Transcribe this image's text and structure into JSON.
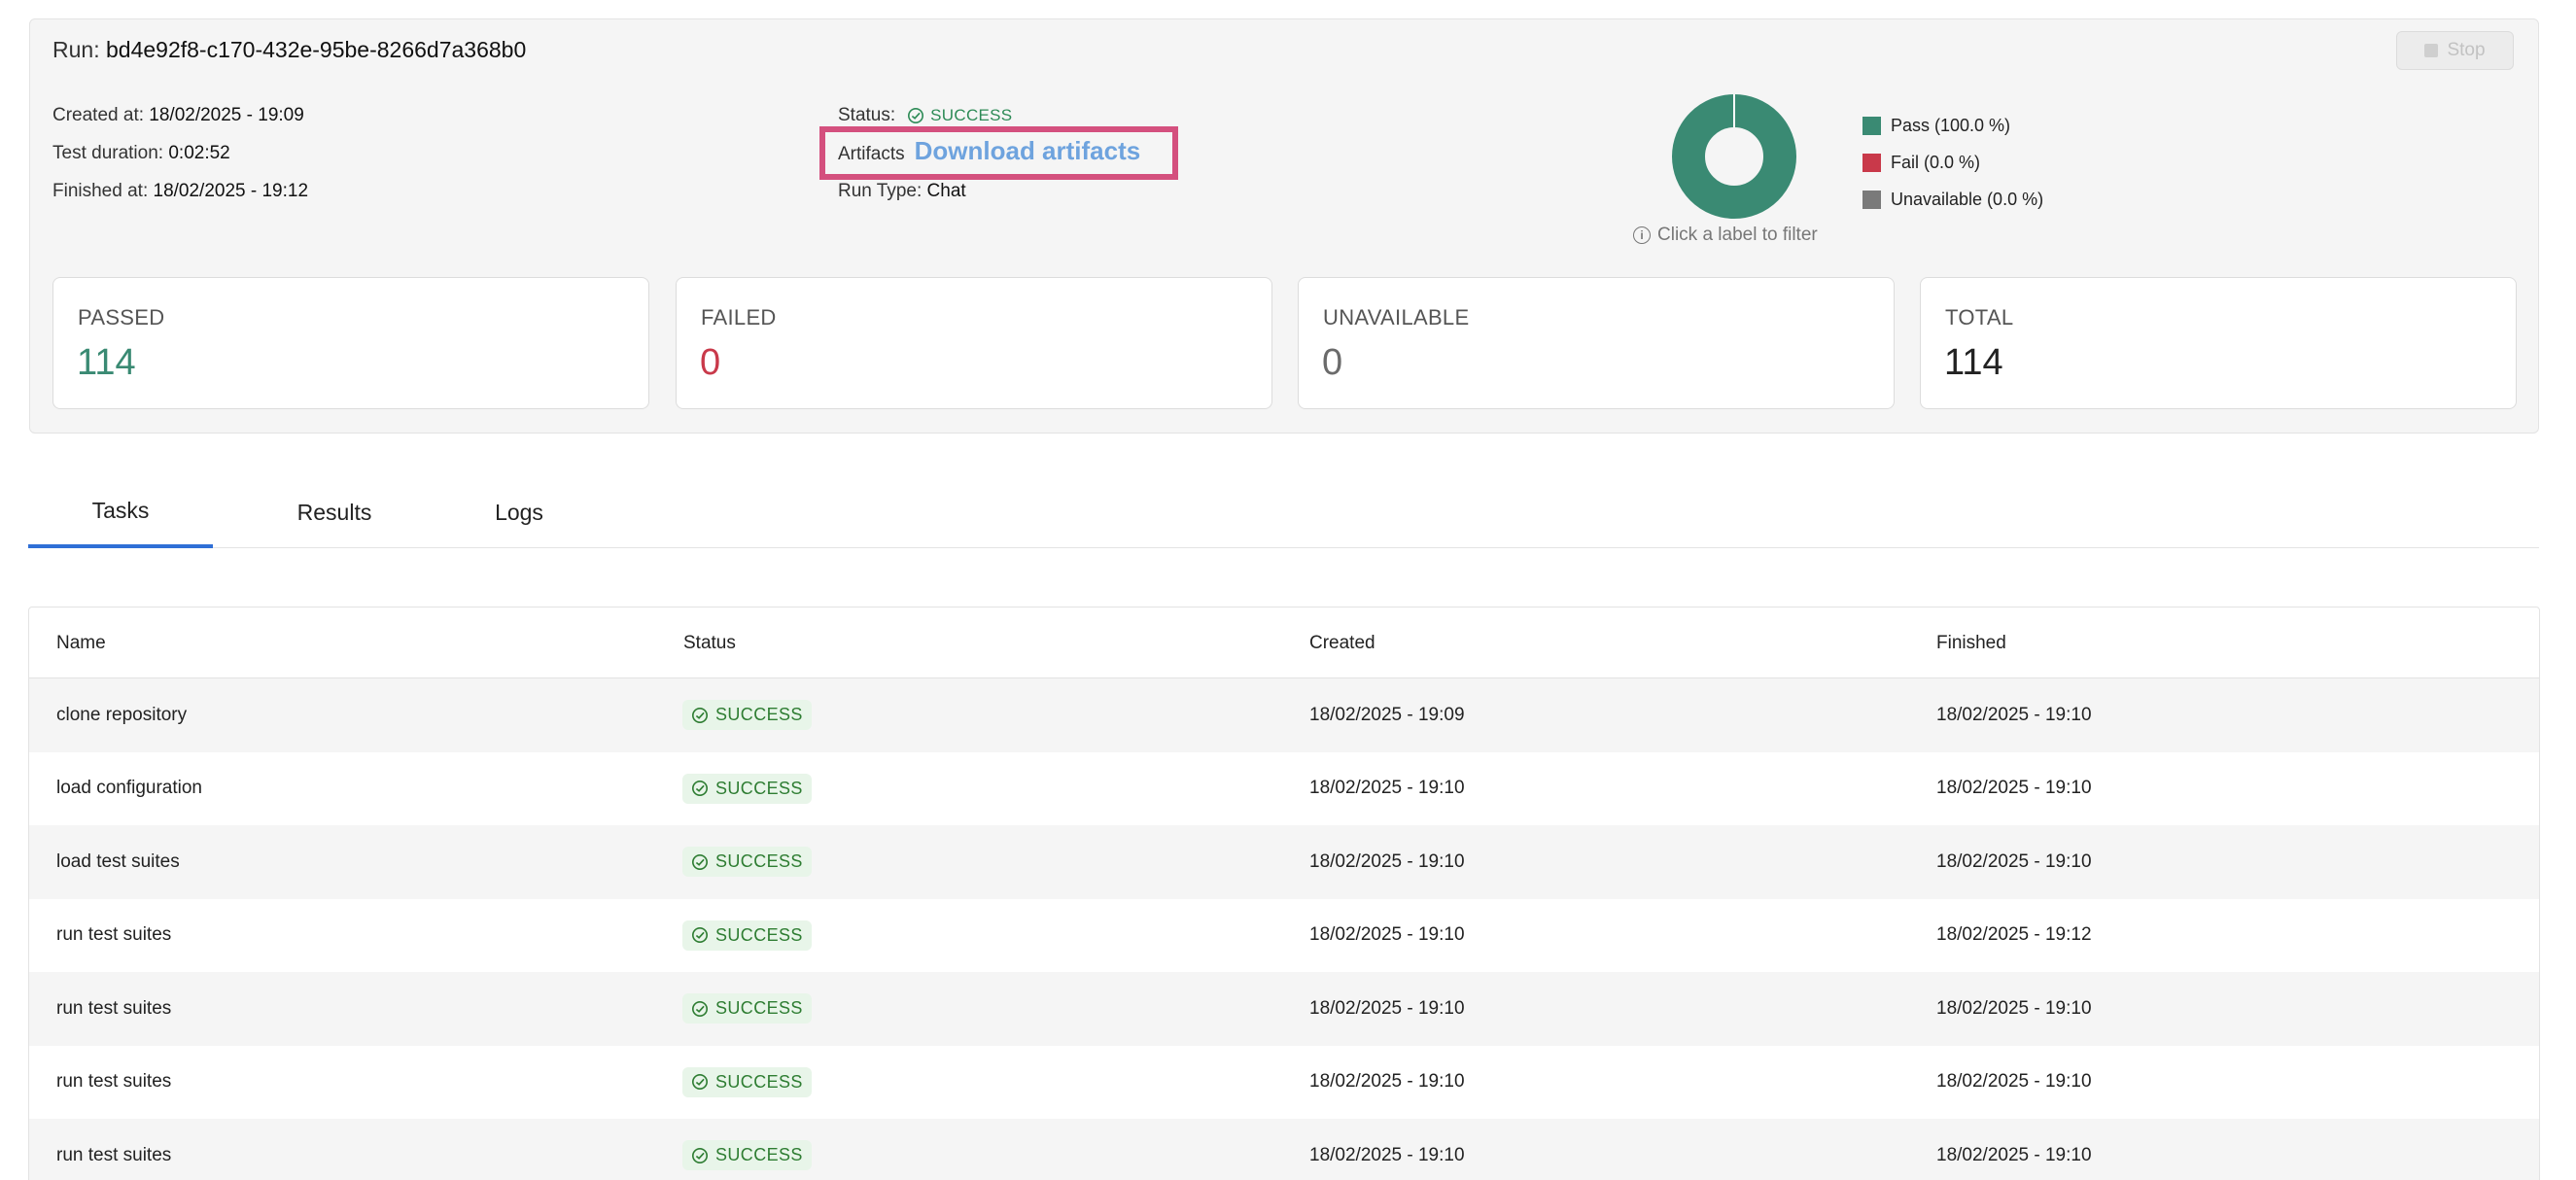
{
  "run": {
    "label": "Run:",
    "id": "bd4e92f8-c170-432e-95be-8266d7a368b0",
    "stop_label": "Stop"
  },
  "meta": {
    "created_label": "Created at:",
    "created_value": "18/02/2025 - 19:09",
    "duration_label": "Test duration:",
    "duration_value": "0:02:52",
    "finished_label": "Finished at:",
    "finished_value": "18/02/2025 - 19:12",
    "status_label": "Status:",
    "status_value": "SUCCESS",
    "artifacts_label": "Artifacts",
    "artifacts_link": "Download artifacts",
    "run_type_label": "Run Type:",
    "run_type_value": "Chat"
  },
  "chart_data": {
    "type": "pie",
    "categories": [
      "Pass",
      "Fail",
      "Unavailable"
    ],
    "values": [
      100.0,
      0.0,
      0.0
    ],
    "legend": [
      "Pass (100.0 %)",
      "Fail (0.0 %)",
      "Unavailable (0.0 %)"
    ],
    "colors": [
      "#3a8a73",
      "#c9394a",
      "#7a7a7a"
    ],
    "hint": "Click a label to filter",
    "legend_position": "right"
  },
  "cards": [
    {
      "label": "PASSED",
      "value": "114",
      "color": "#3a8a73"
    },
    {
      "label": "FAILED",
      "value": "0",
      "color": "#c9394a"
    },
    {
      "label": "UNAVAILABLE",
      "value": "0",
      "color": "#6b6b6b"
    },
    {
      "label": "TOTAL",
      "value": "114",
      "color": "#222222"
    }
  ],
  "tabs": [
    {
      "label": "Tasks",
      "active": true
    },
    {
      "label": "Results",
      "active": false
    },
    {
      "label": "Logs",
      "active": false
    }
  ],
  "table": {
    "headers": [
      "Name",
      "Status",
      "Created",
      "Finished"
    ],
    "rows": [
      {
        "name": "clone repository",
        "status": "SUCCESS",
        "created": "18/02/2025 - 19:09",
        "finished": "18/02/2025 - 19:10"
      },
      {
        "name": "load configuration",
        "status": "SUCCESS",
        "created": "18/02/2025 - 19:10",
        "finished": "18/02/2025 - 19:10"
      },
      {
        "name": "load test suites",
        "status": "SUCCESS",
        "created": "18/02/2025 - 19:10",
        "finished": "18/02/2025 - 19:10"
      },
      {
        "name": "run test suites",
        "status": "SUCCESS",
        "created": "18/02/2025 - 19:10",
        "finished": "18/02/2025 - 19:12"
      },
      {
        "name": "run test suites",
        "status": "SUCCESS",
        "created": "18/02/2025 - 19:10",
        "finished": "18/02/2025 - 19:10"
      },
      {
        "name": "run test suites",
        "status": "SUCCESS",
        "created": "18/02/2025 - 19:10",
        "finished": "18/02/2025 - 19:10"
      },
      {
        "name": "run test suites",
        "status": "SUCCESS",
        "created": "18/02/2025 - 19:10",
        "finished": "18/02/2025 - 19:10"
      }
    ]
  },
  "colors": {
    "accent": "#2f6fd6",
    "success": "#2e7d32",
    "highlight": "#d4507e",
    "link": "#6ea3de"
  }
}
